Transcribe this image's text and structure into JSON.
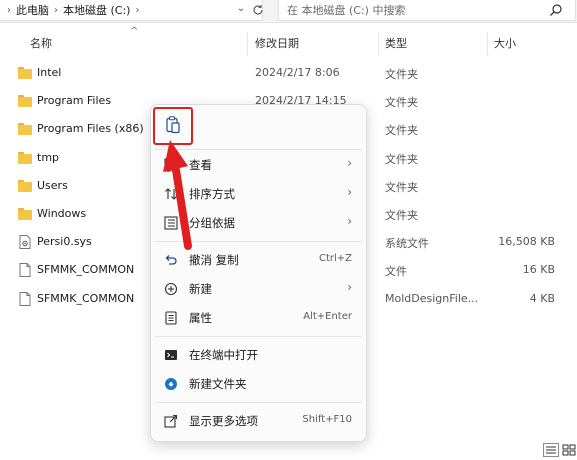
{
  "address_bar": {
    "crumbs": [
      "此电脑",
      "本地磁盘 (C:)"
    ]
  },
  "search": {
    "placeholder": "在 本地磁盘 (C:) 中搜索"
  },
  "columns": {
    "name": "名称",
    "date": "修改日期",
    "type": "类型",
    "size": "大小"
  },
  "files": [
    {
      "name": "Intel",
      "date": "2024/2/17 8:06",
      "type": "文件夹",
      "size": "",
      "icon": "folder-icon"
    },
    {
      "name": "Program Files",
      "date": "2024/2/17 14:15",
      "type": "文件夹",
      "size": "",
      "icon": "folder-icon"
    },
    {
      "name": "Program Files (x86)",
      "date": "",
      "type": "文件夹",
      "size": "",
      "icon": "folder-icon"
    },
    {
      "name": "tmp",
      "date": "",
      "type": "文件夹",
      "size": "",
      "icon": "folder-icon"
    },
    {
      "name": "Users",
      "date": "",
      "type": "文件夹",
      "size": "",
      "icon": "folder-icon"
    },
    {
      "name": "Windows",
      "date": "",
      "type": "文件夹",
      "size": "",
      "icon": "folder-icon"
    },
    {
      "name": "Persi0.sys",
      "date": "",
      "type": "系统文件",
      "size": "16,508 KB",
      "icon": "system-file-icon"
    },
    {
      "name": "SFMMK_COMMON",
      "date": "",
      "type": "文件",
      "size": "16 KB",
      "icon": "file-icon"
    },
    {
      "name": "SFMMK_COMMON",
      "date": "",
      "type": "MoldDesignFile...",
      "size": "4 KB",
      "icon": "file-icon"
    }
  ],
  "context_menu": {
    "paste_icon": "paste-icon",
    "items": [
      {
        "label": "查看",
        "shortcut": "",
        "submenu": true,
        "icon": "grid-view-icon"
      },
      {
        "label": "排序方式",
        "shortcut": "",
        "submenu": true,
        "icon": "sort-icon"
      },
      {
        "label": "分组依据",
        "shortcut": "",
        "submenu": true,
        "icon": "group-icon"
      },
      {
        "label": "撤消 复制",
        "shortcut": "Ctrl+Z",
        "submenu": false,
        "icon": "undo-icon"
      },
      {
        "label": "新建",
        "shortcut": "",
        "submenu": true,
        "icon": "new-icon"
      },
      {
        "label": "属性",
        "shortcut": "Alt+Enter",
        "submenu": false,
        "icon": "properties-icon"
      },
      {
        "label": "在终端中打开",
        "shortcut": "",
        "submenu": false,
        "icon": "terminal-icon"
      },
      {
        "label": "新建文件夹",
        "shortcut": "",
        "submenu": false,
        "icon": "new-folder-icon"
      },
      {
        "label": "显示更多选项",
        "shortcut": "Shift+F10",
        "submenu": false,
        "icon": "more-options-icon"
      }
    ]
  },
  "colors": {
    "folder": "#f5c645",
    "highlight": "#e02020",
    "accent": "#0067c0"
  }
}
